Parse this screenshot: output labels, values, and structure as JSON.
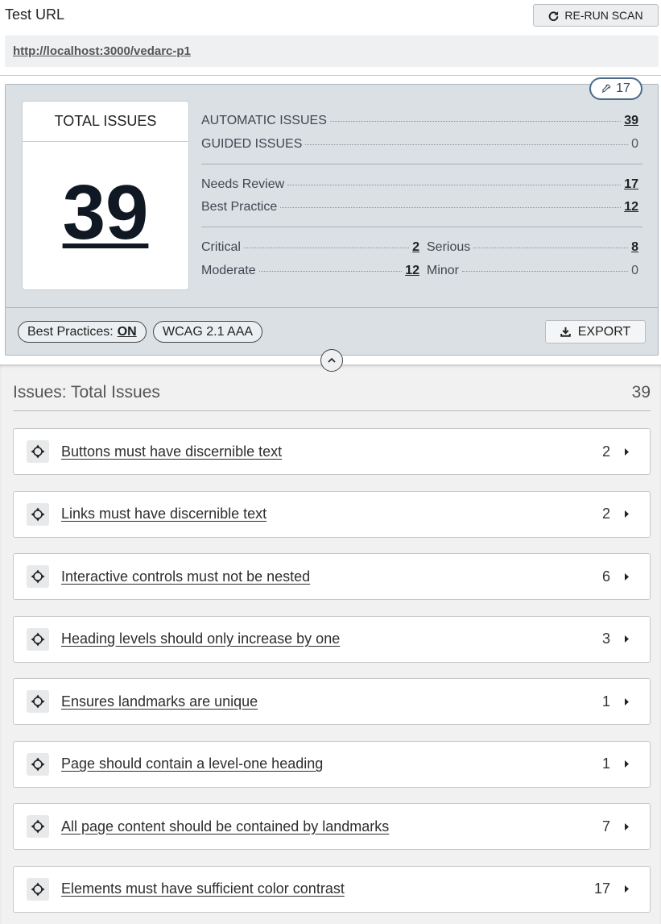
{
  "header": {
    "test_url_label": "Test URL",
    "rerun_label": "RE-RUN SCAN",
    "url": "http://localhost:3000/vedarc-p1"
  },
  "summary": {
    "needs_review_badge": "17",
    "total_label": "TOTAL ISSUES",
    "total_value": "39",
    "automatic_label": "AUTOMATIC ISSUES",
    "automatic_value": "39",
    "guided_label": "GUIDED ISSUES",
    "guided_value": "0",
    "needs_review_label": "Needs Review",
    "needs_review_value": "17",
    "best_practice_label": "Best Practice",
    "best_practice_value": "12",
    "critical_label": "Critical",
    "critical_value": "2",
    "serious_label": "Serious",
    "serious_value": "8",
    "moderate_label": "Moderate",
    "moderate_value": "12",
    "minor_label": "Minor",
    "minor_value": "0",
    "best_practices_toggle_label": "Best Practices:",
    "best_practices_toggle_value": "ON",
    "standard_label": "WCAG 2.1 AAA",
    "export_label": "EXPORT"
  },
  "issues": {
    "heading": "Issues: Total Issues",
    "total": "39",
    "items": [
      {
        "title": "Buttons must have discernible text",
        "count": "2"
      },
      {
        "title": "Links must have discernible text",
        "count": "2"
      },
      {
        "title": "Interactive controls must not be nested",
        "count": "6"
      },
      {
        "title": "Heading levels should only increase by one",
        "count": "3"
      },
      {
        "title": "Ensures landmarks are unique",
        "count": "1"
      },
      {
        "title": "Page should contain a level-one heading",
        "count": "1"
      },
      {
        "title": "All page content should be contained by landmarks",
        "count": "7"
      },
      {
        "title": "Elements must have sufficient color contrast",
        "count": "17"
      }
    ]
  },
  "icons": {
    "rerun": "refresh-icon",
    "needs_review": "eyedropper-icon",
    "export": "download-icon",
    "collapse": "chevron-up-icon",
    "target": "crosshair-icon",
    "expand": "caret-right-icon"
  }
}
